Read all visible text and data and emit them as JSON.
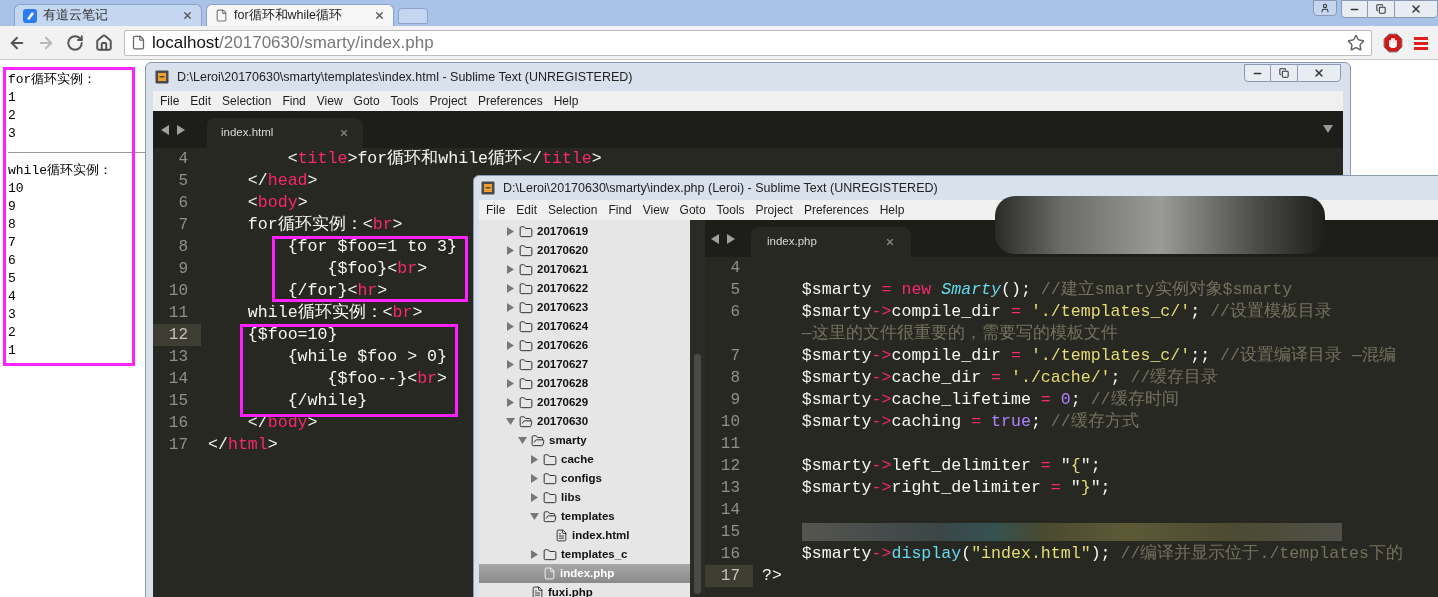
{
  "browser": {
    "tabs": [
      {
        "title": "有道云笔记",
        "selected": false,
        "kind": "note"
      },
      {
        "title": "for循环和while循环",
        "selected": true,
        "kind": "page"
      }
    ],
    "nav": [
      {
        "kind": "back",
        "disabled": false
      },
      {
        "kind": "forward",
        "disabled": true
      },
      {
        "kind": "reload",
        "disabled": false
      },
      {
        "kind": "home",
        "disabled": false
      }
    ],
    "address": {
      "host": "localhost",
      "path": "/20170630/smarty/index.php"
    }
  },
  "page_output": {
    "for_heading": "for循环实例：",
    "for_values": [
      "1",
      "2",
      "3"
    ],
    "while_heading": "while循环实例：",
    "while_values": [
      "10",
      "9",
      "8",
      "7",
      "6",
      "5",
      "4",
      "3",
      "2",
      "1"
    ]
  },
  "editor_html": {
    "title": "D:\\Leroi\\20170630\\smarty\\templates\\index.html - Sublime Text (UNREGISTERED)",
    "menu": [
      "File",
      "Edit",
      "Selection",
      "Find",
      "View",
      "Goto",
      "Tools",
      "Project",
      "Preferences",
      "Help"
    ],
    "tab": "index.html",
    "lines": [
      {
        "number": "4",
        "current": false,
        "tokens": [
          {
            "kind": "plain",
            "text": "        <"
          },
          {
            "kind": "tag",
            "text": "title"
          },
          {
            "kind": "plain",
            "text": ">for循环和while循环</"
          },
          {
            "kind": "tag",
            "text": "title"
          },
          {
            "kind": "plain",
            "text": ">"
          }
        ]
      },
      {
        "number": "5",
        "current": false,
        "tokens": [
          {
            "kind": "plain",
            "text": "    </"
          },
          {
            "kind": "tag",
            "text": "head"
          },
          {
            "kind": "plain",
            "text": ">"
          }
        ]
      },
      {
        "number": "6",
        "current": false,
        "tokens": [
          {
            "kind": "plain",
            "text": "    <"
          },
          {
            "kind": "tag",
            "text": "body"
          },
          {
            "kind": "plain",
            "text": ">"
          }
        ]
      },
      {
        "number": "7",
        "current": false,
        "tokens": [
          {
            "kind": "plain",
            "text": "    for循环实例：<"
          },
          {
            "kind": "tag",
            "text": "br"
          },
          {
            "kind": "plain",
            "text": ">"
          }
        ]
      },
      {
        "number": "8",
        "current": false,
        "tokens": [
          {
            "kind": "plain",
            "text": "        {for $foo=1 to 3}"
          }
        ]
      },
      {
        "number": "9",
        "current": false,
        "tokens": [
          {
            "kind": "plain",
            "text": "            {$foo}<"
          },
          {
            "kind": "tag",
            "text": "br"
          },
          {
            "kind": "plain",
            "text": ">"
          }
        ]
      },
      {
        "number": "10",
        "current": false,
        "tokens": [
          {
            "kind": "plain",
            "text": "        {/for}<"
          },
          {
            "kind": "tag",
            "text": "hr"
          },
          {
            "kind": "plain",
            "text": ">"
          }
        ]
      },
      {
        "number": "11",
        "current": false,
        "tokens": [
          {
            "kind": "plain",
            "text": "    while循环实例：<"
          },
          {
            "kind": "tag",
            "text": "br"
          },
          {
            "kind": "plain",
            "text": ">"
          }
        ]
      },
      {
        "number": "12",
        "current": true,
        "tokens": [
          {
            "kind": "plain",
            "text": "    {$foo=10}"
          }
        ]
      },
      {
        "number": "13",
        "current": false,
        "tokens": [
          {
            "kind": "plain",
            "text": "        {while $foo > 0}"
          }
        ]
      },
      {
        "number": "14",
        "current": false,
        "tokens": [
          {
            "kind": "plain",
            "text": "            {$foo--}<"
          },
          {
            "kind": "tag",
            "text": "br"
          },
          {
            "kind": "plain",
            "text": ">"
          }
        ]
      },
      {
        "number": "15",
        "current": false,
        "tokens": [
          {
            "kind": "plain",
            "text": "        {/while}"
          }
        ]
      },
      {
        "number": "16",
        "current": false,
        "tokens": [
          {
            "kind": "plain",
            "text": "    </"
          },
          {
            "kind": "tag",
            "text": "body"
          },
          {
            "kind": "plain",
            "text": ">"
          }
        ]
      },
      {
        "number": "17",
        "current": false,
        "tokens": [
          {
            "kind": "plain",
            "text": "</"
          },
          {
            "kind": "tag",
            "text": "html"
          },
          {
            "kind": "plain",
            "text": ">"
          }
        ]
      }
    ]
  },
  "editor_php": {
    "title": "D:\\Leroi\\20170630\\smarty\\index.php (Leroi) - Sublime Text (UNREGISTERED)",
    "menu": [
      "File",
      "Edit",
      "Selection",
      "Find",
      "View",
      "Goto",
      "Tools",
      "Project",
      "Preferences",
      "Help"
    ],
    "tab": "index.php",
    "sidebar": [
      {
        "kind": "folder",
        "name": "20170619",
        "expanded": false,
        "selected": false
      },
      {
        "kind": "folder",
        "name": "20170620",
        "expanded": false,
        "selected": false
      },
      {
        "kind": "folder",
        "name": "20170621",
        "expanded": false,
        "selected": false
      },
      {
        "kind": "folder",
        "name": "20170622",
        "expanded": false,
        "selected": false
      },
      {
        "kind": "folder",
        "name": "20170623",
        "expanded": false,
        "selected": false
      },
      {
        "kind": "folder",
        "name": "20170624",
        "expanded": false,
        "selected": false
      },
      {
        "kind": "folder",
        "name": "20170626",
        "expanded": false,
        "selected": false
      },
      {
        "kind": "folder",
        "name": "20170627",
        "expanded": false,
        "selected": false
      },
      {
        "kind": "folder",
        "name": "20170628",
        "expanded": false,
        "selected": false
      },
      {
        "kind": "folder",
        "name": "20170629",
        "expanded": false,
        "selected": false
      },
      {
        "kind": "folder",
        "name": "20170630",
        "expanded": true,
        "selected": false,
        "children": [
          {
            "kind": "folder",
            "name": "smarty",
            "expanded": true,
            "selected": false,
            "children": [
              {
                "kind": "folder",
                "name": "cache",
                "expanded": false,
                "selected": false
              },
              {
                "kind": "folder",
                "name": "configs",
                "expanded": false,
                "selected": false
              },
              {
                "kind": "folder",
                "name": "libs",
                "expanded": false,
                "selected": false
              },
              {
                "kind": "folder",
                "name": "templates",
                "expanded": true,
                "selected": false,
                "children": [
                  {
                    "kind": "file",
                    "name": "index.html",
                    "selected": false
                  }
                ]
              },
              {
                "kind": "folder",
                "name": "templates_c",
                "expanded": false,
                "selected": false
              },
              {
                "kind": "file",
                "name": "index.php",
                "selected": true
              }
            ]
          },
          {
            "kind": "file",
            "name": "fuxi.php",
            "selected": false
          }
        ]
      }
    ],
    "lines": [
      {
        "number": "4",
        "current": false
      },
      {
        "number": "5",
        "current": false,
        "tokens": [
          {
            "kind": "plain",
            "text": "    $smarty "
          },
          {
            "kind": "op",
            "text": "= "
          },
          {
            "kind": "op",
            "text": "new "
          },
          {
            "kind": "class",
            "text": "Smarty"
          },
          {
            "kind": "plain",
            "text": "(); "
          },
          {
            "kind": "comment",
            "text": "//建立smarty实例对象$smarty"
          }
        ]
      },
      {
        "number": "6",
        "current": false,
        "tokens": [
          {
            "kind": "plain",
            "text": "    $smarty"
          },
          {
            "kind": "op",
            "text": "->"
          },
          {
            "kind": "plain",
            "text": "compile_dir "
          },
          {
            "kind": "op",
            "text": "= "
          },
          {
            "kind": "string",
            "text": "'./templates_c/'"
          },
          {
            "kind": "plain",
            "text": "; "
          },
          {
            "kind": "comment",
            "text": "//设置模板目录"
          }
        ]
      },
      {
        "current": false,
        "tokens": [
          {
            "kind": "comment",
            "text": "    —这里的文件很重要的，需要写的模板文件"
          }
        ]
      },
      {
        "number": "7",
        "current": false,
        "tokens": [
          {
            "kind": "plain",
            "text": "    $smarty"
          },
          {
            "kind": "op",
            "text": "->"
          },
          {
            "kind": "plain",
            "text": "compile_dir "
          },
          {
            "kind": "op",
            "text": "= "
          },
          {
            "kind": "string",
            "text": "'./templates_c/'"
          },
          {
            "kind": "plain",
            "text": ";; "
          },
          {
            "kind": "comment",
            "text": "//设置编译目录 —混编"
          }
        ]
      },
      {
        "number": "8",
        "current": false,
        "tokens": [
          {
            "kind": "plain",
            "text": "    $smarty"
          },
          {
            "kind": "op",
            "text": "->"
          },
          {
            "kind": "plain",
            "text": "cache_dir "
          },
          {
            "kind": "op",
            "text": "= "
          },
          {
            "kind": "string",
            "text": "'./cache/'"
          },
          {
            "kind": "plain",
            "text": "; "
          },
          {
            "kind": "comment",
            "text": "//缓存目录"
          }
        ]
      },
      {
        "number": "9",
        "current": false,
        "tokens": [
          {
            "kind": "plain",
            "text": "    $smarty"
          },
          {
            "kind": "op",
            "text": "->"
          },
          {
            "kind": "plain",
            "text": "cache_lifetime "
          },
          {
            "kind": "op",
            "text": "= "
          },
          {
            "kind": "constant",
            "text": "0"
          },
          {
            "kind": "plain",
            "text": "; "
          },
          {
            "kind": "comment",
            "text": "//缓存时间"
          }
        ]
      },
      {
        "number": "10",
        "current": false,
        "tokens": [
          {
            "kind": "plain",
            "text": "    $smarty"
          },
          {
            "kind": "op",
            "text": "->"
          },
          {
            "kind": "plain",
            "text": "caching "
          },
          {
            "kind": "op",
            "text": "= "
          },
          {
            "kind": "constant",
            "text": "true"
          },
          {
            "kind": "plain",
            "text": "; "
          },
          {
            "kind": "comment",
            "text": "//缓存方式"
          }
        ]
      },
      {
        "number": "11",
        "current": false
      },
      {
        "number": "12",
        "current": false,
        "tokens": [
          {
            "kind": "plain",
            "text": "    $smarty"
          },
          {
            "kind": "op",
            "text": "->"
          },
          {
            "kind": "plain",
            "text": "left_delimiter "
          },
          {
            "kind": "op",
            "text": "= "
          },
          {
            "kind": "plain",
            "text": "\""
          },
          {
            "kind": "string",
            "text": "{"
          },
          {
            "kind": "plain",
            "text": "\";"
          }
        ]
      },
      {
        "number": "13",
        "current": false,
        "tokens": [
          {
            "kind": "plain",
            "text": "    $smarty"
          },
          {
            "kind": "op",
            "text": "->"
          },
          {
            "kind": "plain",
            "text": "right_delimiter "
          },
          {
            "kind": "op",
            "text": "= "
          },
          {
            "kind": "plain",
            "text": "\""
          },
          {
            "kind": "string",
            "text": "}"
          },
          {
            "kind": "plain",
            "text": "\";"
          }
        ]
      },
      {
        "number": "14",
        "current": false
      },
      {
        "number": "15",
        "current": false,
        "tokens": [
          {
            "kind": "blurred"
          }
        ]
      },
      {
        "number": "16",
        "current": false,
        "tokens": [
          {
            "kind": "plain",
            "text": "    $smarty"
          },
          {
            "kind": "op",
            "text": "->"
          },
          {
            "kind": "function",
            "text": "display"
          },
          {
            "kind": "plain",
            "text": "("
          },
          {
            "kind": "string",
            "text": "\"index.html\""
          },
          {
            "kind": "plain",
            "text": "); "
          },
          {
            "kind": "comment",
            "text": "//编译并显示位于./templates下的"
          }
        ]
      },
      {
        "number": "17",
        "current": true,
        "tokens": [
          {
            "kind": "plain",
            "text": "?>"
          }
        ]
      }
    ]
  }
}
